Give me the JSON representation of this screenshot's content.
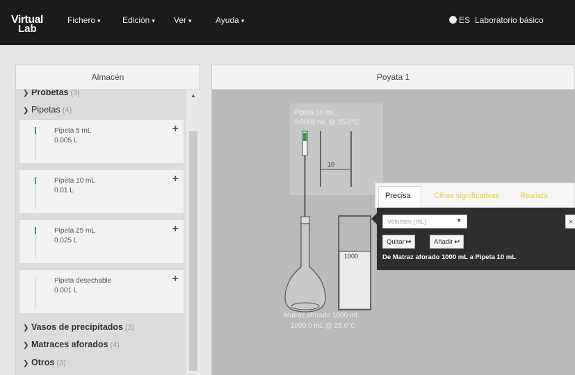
{
  "navbar": {
    "brand_top": "Virtual",
    "brand_bottom": "Lab",
    "menus": [
      {
        "label": "Fichero"
      },
      {
        "label": "Edición"
      },
      {
        "label": "Ver"
      },
      {
        "label": "Ayuda"
      }
    ],
    "language": "ES",
    "lab_name": "Laboratorio básico"
  },
  "storage": {
    "title": "Almacén",
    "categories": {
      "probetas": {
        "label": "Probetas",
        "count": "(3)"
      },
      "pipetas": {
        "label": "Pipetas",
        "count": "(4)"
      },
      "vasos": {
        "label": "Vasos de precipitados",
        "count": "(3)"
      },
      "matraces": {
        "label": "Matraces aforados",
        "count": "(4)"
      },
      "otros": {
        "label": "Otros",
        "count": "(3)"
      }
    },
    "pipettes": [
      {
        "name": "Pipeta 5 mL",
        "volume": "0.005 L"
      },
      {
        "name": "Pipeta 10 mL",
        "volume": "0.01 L"
      },
      {
        "name": "Pipeta 25 mL",
        "volume": "0.025 L"
      },
      {
        "name": "Pipeta desechable",
        "volume": "0.001 L"
      }
    ]
  },
  "workbench": {
    "title": "Poyata 1",
    "pipette_label": "Pipeta 10 mL",
    "pipette_state": "0.0000 mL @ 25.0°C",
    "flask_label": "Matraz aforado 1000 mL",
    "flask_state": "1000.0 mL @ 25.0°C",
    "pipette_scale_mark": "10",
    "flask_scale_mark": "1000"
  },
  "transfer": {
    "tabs": [
      "Precisa",
      "Cifras significativas",
      "Realista"
    ],
    "volume_placeholder": "Volumen (mL)",
    "remove_label": "Quitar",
    "add_label": "Añadir",
    "close_label": "×",
    "status": "De Matraz aforado 1000 mL a Pipeta 10 mL"
  },
  "colors": {
    "navbar": "#1b1b1b",
    "accent_green": "#3a9a4a",
    "tab_yellow": "#e0d23a",
    "popover_dark": "#2e2e2e"
  }
}
